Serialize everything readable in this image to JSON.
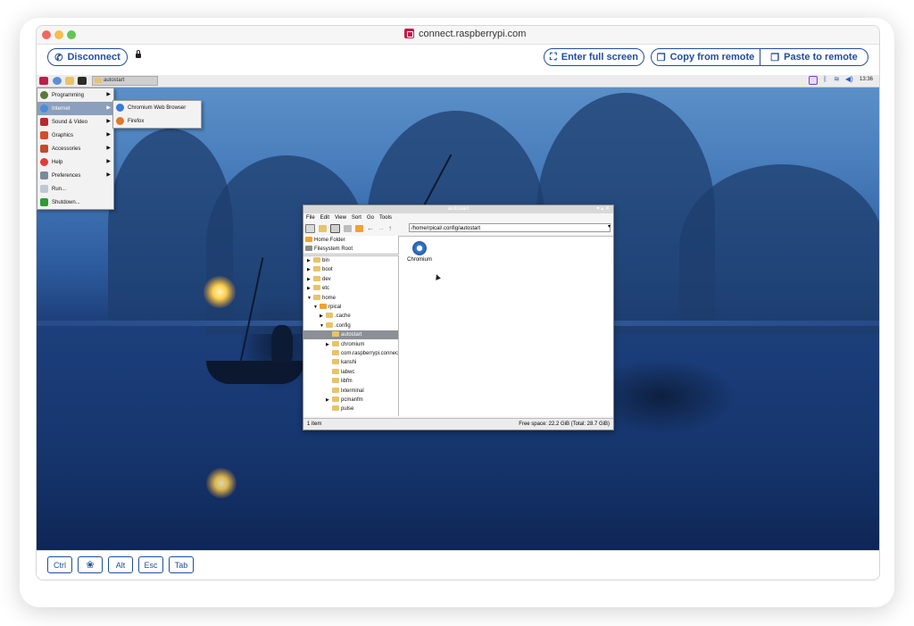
{
  "browser": {
    "url": "connect.raspberrypi.com",
    "traffic_lights": {
      "close": "#ed6a5e",
      "minimize": "#f5be4f",
      "zoom": "#62c554"
    }
  },
  "toolbar": {
    "disconnect_label": "Disconnect",
    "fullscreen_label": "Enter full screen",
    "copy_label": "Copy from remote",
    "paste_label": "Paste to remote",
    "accent": "#1f4e9c"
  },
  "taskbar": {
    "task_label": "autostart",
    "clock": "13:36"
  },
  "start_menu": {
    "items": [
      {
        "label": "Programming",
        "icon": "programming-icon"
      },
      {
        "label": "Internet",
        "icon": "internet-globe-icon"
      },
      {
        "label": "Sound & Video",
        "icon": "sound-video-icon"
      },
      {
        "label": "Graphics",
        "icon": "graphics-icon"
      },
      {
        "label": "Accessories",
        "icon": "accessories-icon"
      },
      {
        "label": "Help",
        "icon": "help-lifebuoy-icon"
      },
      {
        "label": "Preferences",
        "icon": "preferences-icon"
      },
      {
        "label": "Run...",
        "icon": "run-icon"
      },
      {
        "label": "Shutdown...",
        "icon": "shutdown-icon"
      }
    ],
    "internet_submenu": [
      {
        "label": "Chromium Web Browser",
        "icon": "chromium-icon"
      },
      {
        "label": "Firefox",
        "icon": "firefox-icon"
      }
    ]
  },
  "file_manager": {
    "title": "autostart",
    "menus": [
      "File",
      "Edit",
      "View",
      "Sort",
      "Go",
      "Tools"
    ],
    "path": "/home/rpical/.config/autostart",
    "places": [
      "Home Folder",
      "Filesystem Root"
    ],
    "tree": [
      {
        "label": "bin",
        "depth": 0,
        "arrow": "right"
      },
      {
        "label": "boot",
        "depth": 0,
        "arrow": "right"
      },
      {
        "label": "dev",
        "depth": 0,
        "arrow": "right"
      },
      {
        "label": "etc",
        "depth": 0,
        "arrow": "right"
      },
      {
        "label": "home",
        "depth": 0,
        "arrow": "down"
      },
      {
        "label": "rpical",
        "depth": 1,
        "arrow": "down"
      },
      {
        "label": ".cache",
        "depth": 2,
        "arrow": "right"
      },
      {
        "label": ".config",
        "depth": 2,
        "arrow": "down"
      },
      {
        "label": "autostart",
        "depth": 3,
        "arrow": "",
        "selected": true
      },
      {
        "label": "chromium",
        "depth": 3,
        "arrow": "right"
      },
      {
        "label": "com.raspberrypi.connect",
        "depth": 3,
        "arrow": ""
      },
      {
        "label": "kanshi",
        "depth": 3,
        "arrow": ""
      },
      {
        "label": "labwc",
        "depth": 3,
        "arrow": ""
      },
      {
        "label": "libfm",
        "depth": 3,
        "arrow": ""
      },
      {
        "label": "lxterminal",
        "depth": 3,
        "arrow": ""
      },
      {
        "label": "pcmanfm",
        "depth": 3,
        "arrow": "right"
      },
      {
        "label": "pulse",
        "depth": 3,
        "arrow": ""
      }
    ],
    "files": [
      {
        "label": "Chromium",
        "icon": "chromium-icon"
      }
    ],
    "status_left": "1 item",
    "status_right": "Free space: 22.2 GiB (Total: 28.7 GiB)"
  },
  "keys": [
    "Ctrl",
    "",
    "Alt",
    "Esc",
    "Tab"
  ]
}
